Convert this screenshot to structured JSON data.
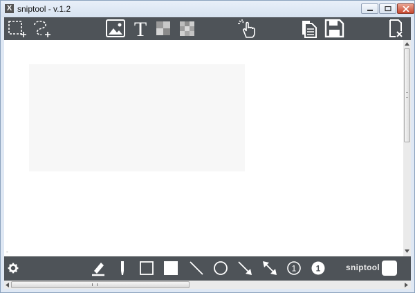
{
  "window": {
    "title": "sniptool - v.1.2",
    "app_icon_glyph": "X"
  },
  "top_toolbar": {
    "tools": [
      "rect-select-icon",
      "freeform-select-icon",
      "image-icon",
      "text-icon",
      "pixelate-icon",
      "blur-icon",
      "pointer-hand-icon",
      "copy-icon",
      "save-icon",
      "close-file-icon"
    ],
    "text_tool_glyph": "T"
  },
  "canvas": {
    "background": "#ffffff",
    "marker": "-"
  },
  "bottom_toolbar": {
    "tools": [
      "settings-icon",
      "highlighter-icon",
      "marker-icon",
      "rectangle-outline-icon",
      "rectangle-filled-icon",
      "line-icon",
      "ellipse-icon",
      "arrow-icon",
      "double-arrow-icon",
      "number-outline-icon",
      "number-filled-icon",
      "color-swatch-icon"
    ],
    "number_outline_label": "1",
    "number_filled_label": "1",
    "brand": "sniptool",
    "current_color": "#ffffff"
  },
  "scrollbars": {
    "h_grip": "III"
  },
  "colors": {
    "toolbar": "#4e5358",
    "icon": "#ffffff"
  }
}
